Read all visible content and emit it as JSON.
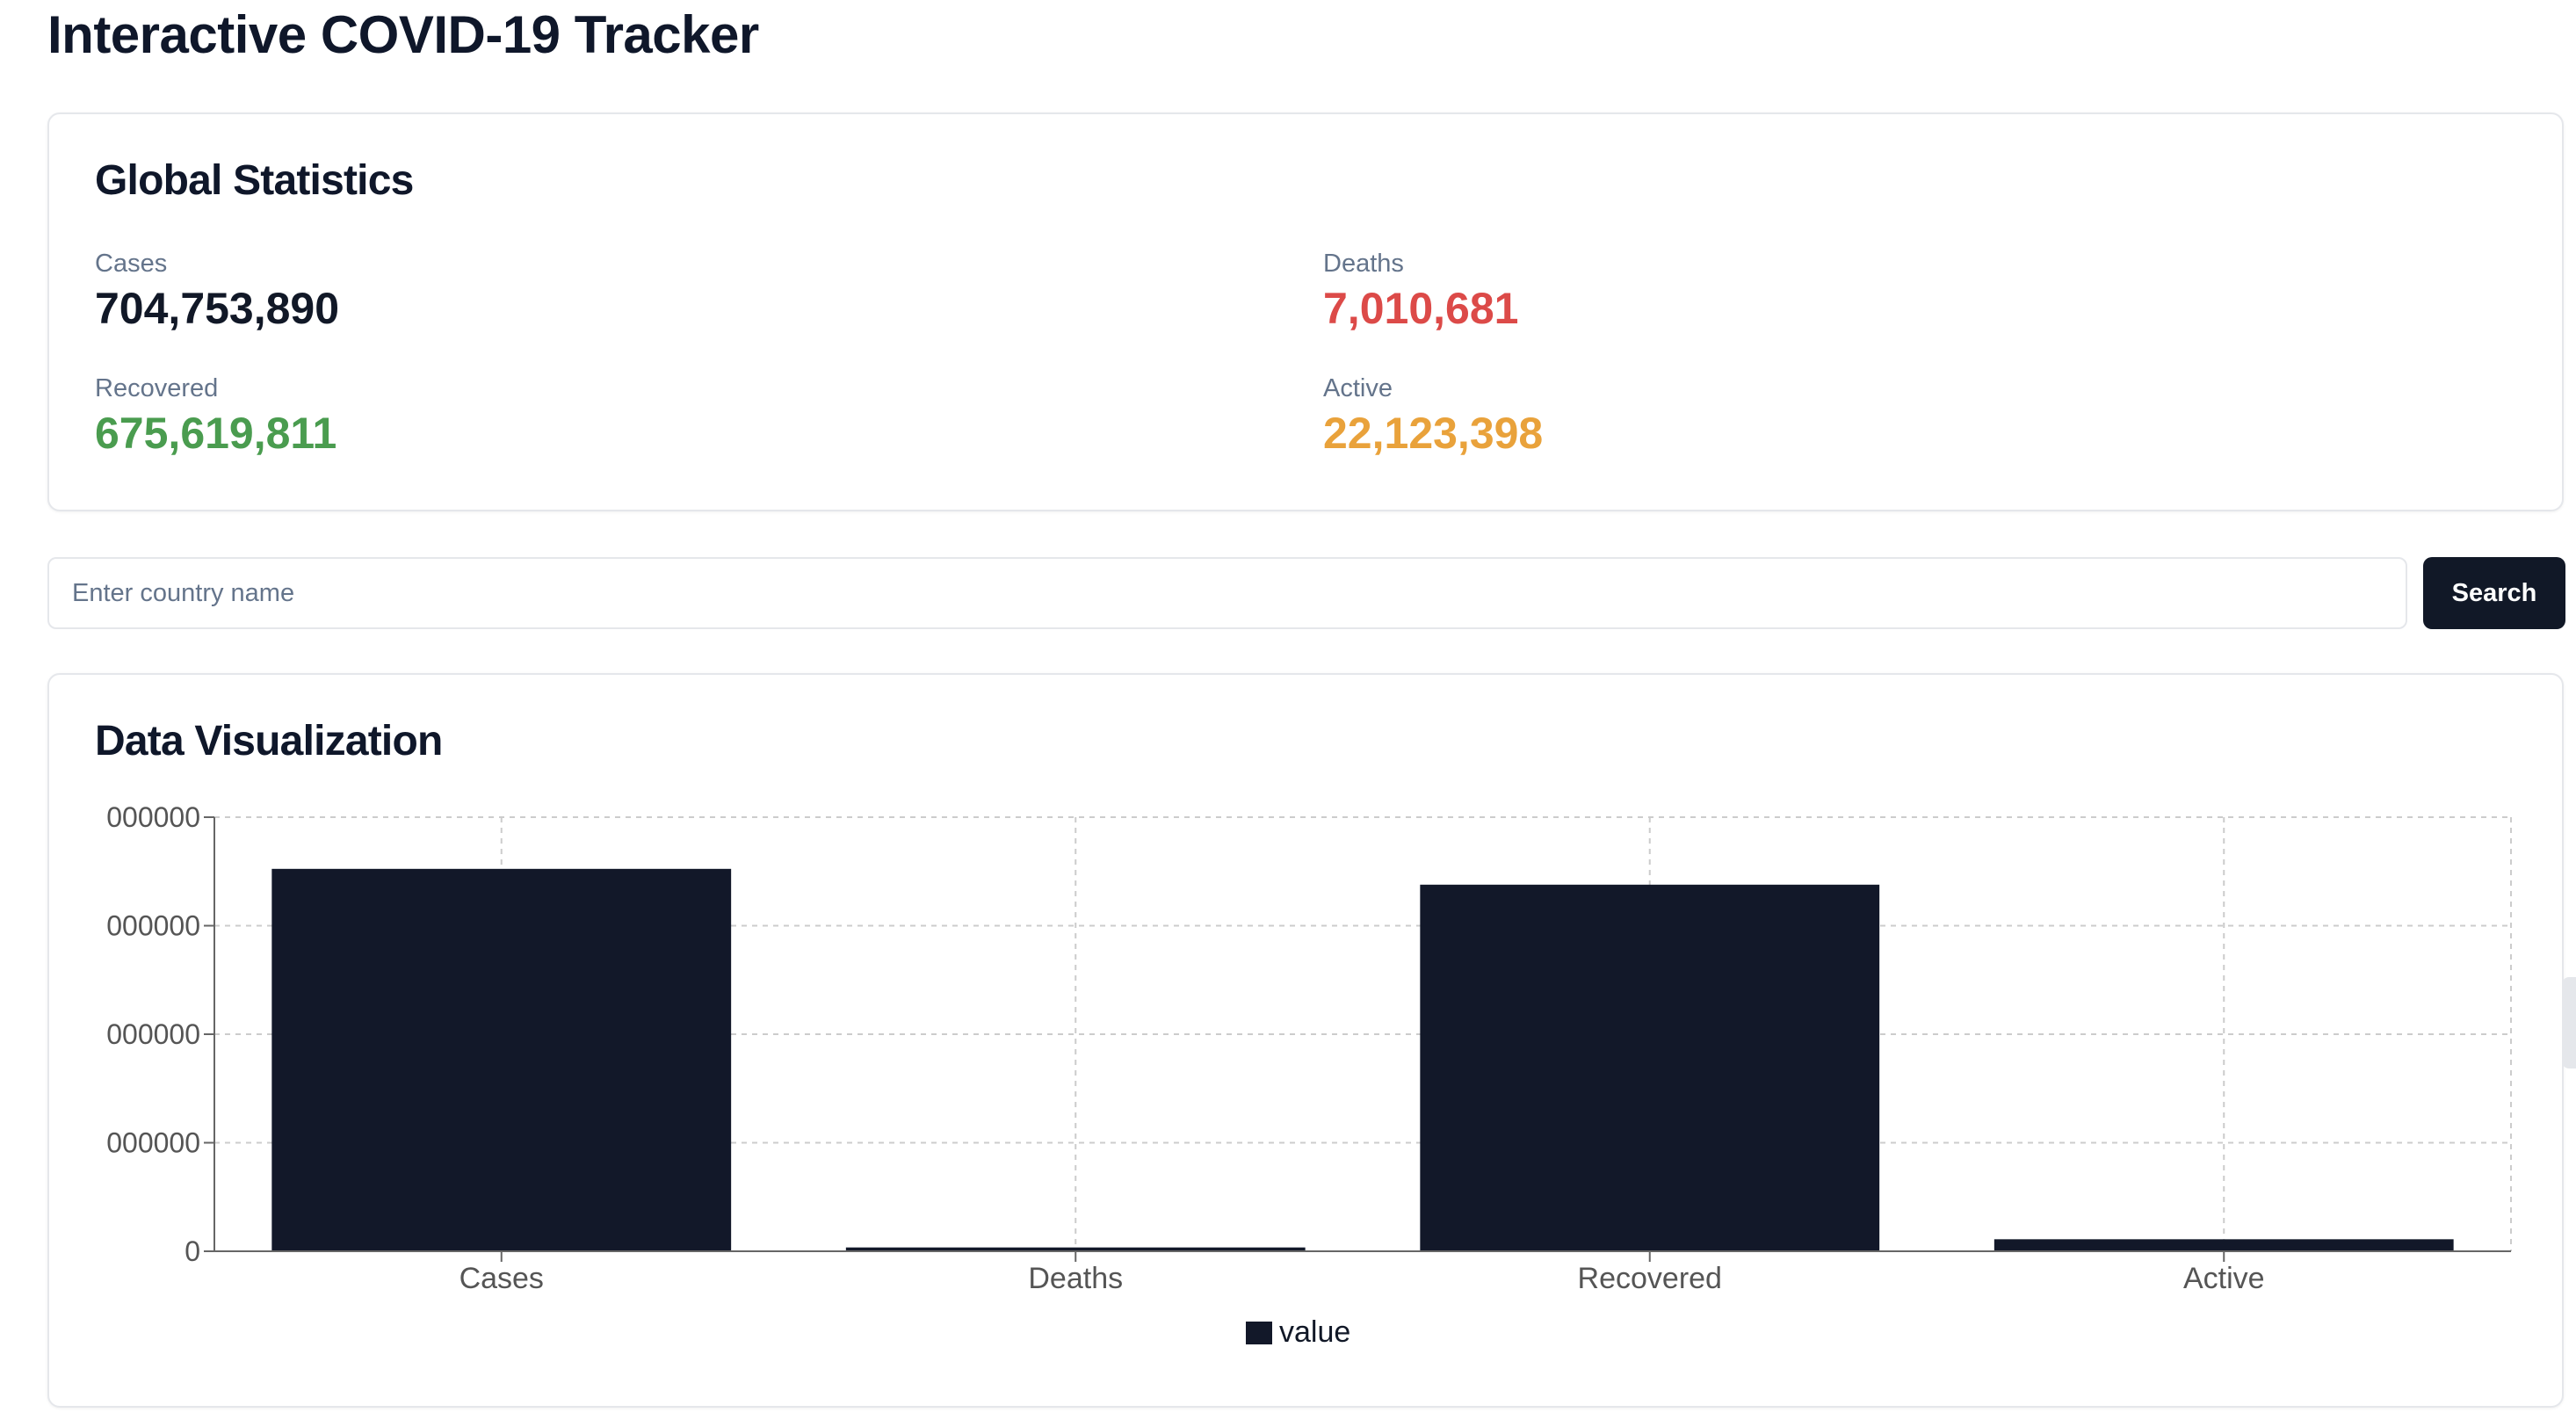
{
  "page": {
    "title": "Interactive COVID-19 Tracker"
  },
  "stats": {
    "title": "Global Statistics",
    "items": [
      {
        "label": "Cases",
        "value": "704,753,890",
        "color": "#111827"
      },
      {
        "label": "Deaths",
        "value": "7,010,681",
        "color": "#dc4a48"
      },
      {
        "label": "Recovered",
        "value": "675,619,811",
        "color": "#4a9c4f"
      },
      {
        "label": "Active",
        "value": "22,123,398",
        "color": "#e9a23b"
      }
    ]
  },
  "search": {
    "placeholder": "Enter country name",
    "value": "",
    "button_label": "Search"
  },
  "visualization": {
    "title": "Data Visualization"
  },
  "chart_data": {
    "type": "bar",
    "categories": [
      "Cases",
      "Deaths",
      "Recovered",
      "Active"
    ],
    "series": [
      {
        "name": "value",
        "values": [
          704753890,
          7010681,
          675619811,
          22123398
        ],
        "color": "#121829"
      }
    ],
    "y_tick_labels": [
      "0",
      "000000",
      "000000",
      "000000",
      "000000"
    ],
    "ylim": [
      0,
      800000000
    ],
    "grid": true,
    "legend": "bottom-center"
  }
}
